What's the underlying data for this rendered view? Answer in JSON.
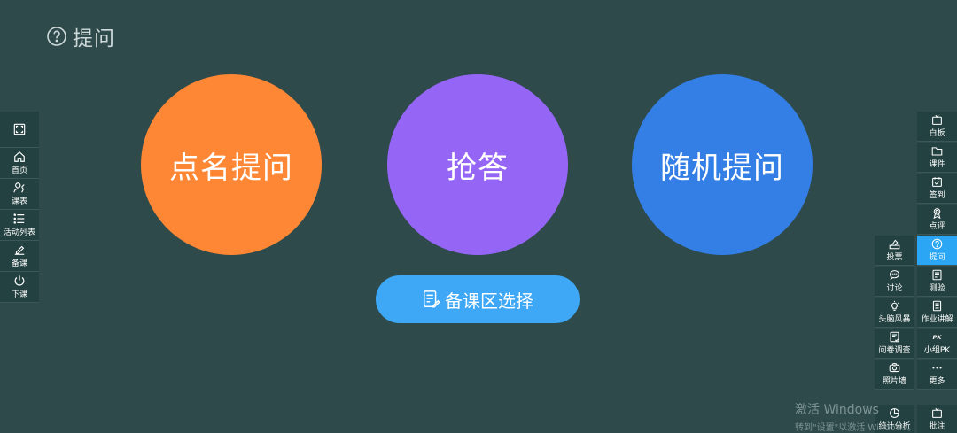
{
  "header": {
    "title": "提问"
  },
  "options": [
    {
      "label": "点名提问",
      "color": "#fd8734"
    },
    {
      "label": "抢答",
      "color": "#9566f6"
    },
    {
      "label": "随机提问",
      "color": "#347fe6"
    }
  ],
  "prep_button": {
    "label": "备课区选择",
    "color": "#3ea7f6"
  },
  "left_toolbar": [
    {
      "label": "",
      "icon": "fullscreen-icon"
    },
    {
      "label": "首页",
      "icon": "home-icon"
    },
    {
      "label": "课表",
      "icon": "schedule-icon"
    },
    {
      "label": "活动列表",
      "icon": "list-icon"
    },
    {
      "label": "备课",
      "icon": "edit-icon"
    },
    {
      "label": "下课",
      "icon": "power-icon"
    }
  ],
  "right_toolbar": {
    "col_right": [
      {
        "label": "白板",
        "icon": "whiteboard-icon"
      },
      {
        "label": "课件",
        "icon": "folder-icon"
      },
      {
        "label": "签到",
        "icon": "checkin-icon"
      },
      {
        "label": "点评",
        "icon": "award-icon"
      },
      {
        "label": "提问",
        "icon": "question-icon",
        "active": true
      },
      {
        "label": "测验",
        "icon": "quiz-icon"
      },
      {
        "label": "作业讲解",
        "icon": "homework-icon"
      },
      {
        "label": "小组PK",
        "icon": "pk-icon"
      },
      {
        "label": "更多",
        "icon": "more-icon"
      },
      {
        "label": "批注",
        "icon": "annotate-icon"
      }
    ],
    "col_left": [
      {
        "label": "投票",
        "icon": "vote-icon"
      },
      {
        "label": "讨论",
        "icon": "discussion-icon"
      },
      {
        "label": "头脑风暴",
        "icon": "brainstorm-icon"
      },
      {
        "label": "问卷调查",
        "icon": "survey-icon"
      },
      {
        "label": "照片墙",
        "icon": "photo-wall-icon"
      },
      {
        "label": "统计分析",
        "icon": "stats-icon"
      }
    ]
  },
  "watermark": {
    "line1": "激活 Windows",
    "line2": "转到\"设置\"以激活 Windows。"
  },
  "accent_active": "#2aa6f4"
}
